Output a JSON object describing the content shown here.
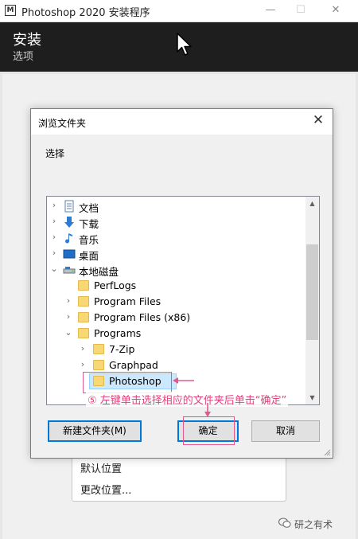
{
  "window": {
    "title": "Photoshop 2020 安装程序",
    "app_icon_text": "M",
    "min_glyph": "—",
    "max_glyph": "☐",
    "close_glyph": "✕"
  },
  "header": {
    "title": "安装",
    "subtitle": "选项"
  },
  "location_menu": {
    "items": [
      "默认位置",
      "更改位置..."
    ]
  },
  "dialog": {
    "title": "浏览文件夹",
    "close_glyph": "✕",
    "instruction": "选择",
    "tree": [
      {
        "label": "文档",
        "icon": "document-icon",
        "expanded": false,
        "indent": 0
      },
      {
        "label": "下载",
        "icon": "download-arrow-icon",
        "expanded": false,
        "indent": 0
      },
      {
        "label": "音乐",
        "icon": "music-note-icon",
        "expanded": false,
        "indent": 0
      },
      {
        "label": "桌面",
        "icon": "desktop-icon",
        "expanded": false,
        "indent": 0
      },
      {
        "label": "本地磁盘",
        "icon": "drive-icon",
        "expanded": true,
        "indent": 0
      },
      {
        "label": "PerfLogs",
        "icon": "folder-icon",
        "expanded": null,
        "indent": 1
      },
      {
        "label": "Program Files",
        "icon": "folder-icon",
        "expanded": false,
        "indent": 1
      },
      {
        "label": "Program Files (x86)",
        "icon": "folder-icon",
        "expanded": false,
        "indent": 1
      },
      {
        "label": "Programs",
        "icon": "folder-icon",
        "expanded": true,
        "indent": 1
      },
      {
        "label": "7-Zip",
        "icon": "folder-icon",
        "expanded": false,
        "indent": 2
      },
      {
        "label": "Graphpad",
        "icon": "folder-icon",
        "expanded": false,
        "indent": 2
      },
      {
        "label": "Photoshop",
        "icon": "folder-icon",
        "expanded": null,
        "indent": 2,
        "selected": true
      }
    ],
    "buttons": {
      "new_folder": "新建文件夹(M)",
      "ok": "确定",
      "cancel": "取消"
    }
  },
  "annotation": {
    "text": "⑤ 左键单击选择相应的文件夹后单击“确定”",
    "color": "#e0407a"
  },
  "watermark": {
    "text": "研之有术"
  },
  "colors": {
    "header_bg": "#1e1e1e",
    "accent": "#0078d7",
    "selection": "#cce8ff",
    "folder": "#f8d775"
  }
}
